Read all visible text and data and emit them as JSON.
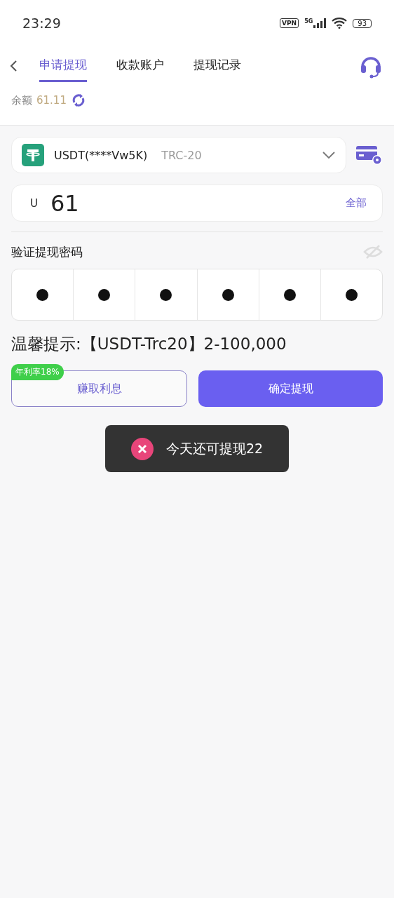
{
  "status_bar": {
    "time": "23:29",
    "vpn": "VPN",
    "network": "5G",
    "battery": "93"
  },
  "nav": {
    "tabs": [
      {
        "label": "申请提现",
        "selected": true
      },
      {
        "label": "收款账户",
        "selected": false
      },
      {
        "label": "提现记录",
        "selected": false
      }
    ]
  },
  "balance": {
    "label": "余额",
    "amount": "61.11"
  },
  "account": {
    "name": "USDT(****Vw5K)",
    "network": "TRC-20"
  },
  "amount": {
    "currency": "U",
    "value": "61",
    "all_label": "全部"
  },
  "password": {
    "label": "验证提现密码",
    "digits": [
      {
        "filled": true
      },
      {
        "filled": true
      },
      {
        "filled": true
      },
      {
        "filled": true
      },
      {
        "filled": true
      },
      {
        "filled": true
      }
    ]
  },
  "tip": "温馨提示:【USDT-Trc20】2-100,000",
  "buttons": {
    "earn": {
      "label": "赚取利息",
      "badge": "年利率18%"
    },
    "confirm": {
      "label": "确定提现"
    }
  },
  "toast": {
    "message": "今天还可提现22"
  }
}
